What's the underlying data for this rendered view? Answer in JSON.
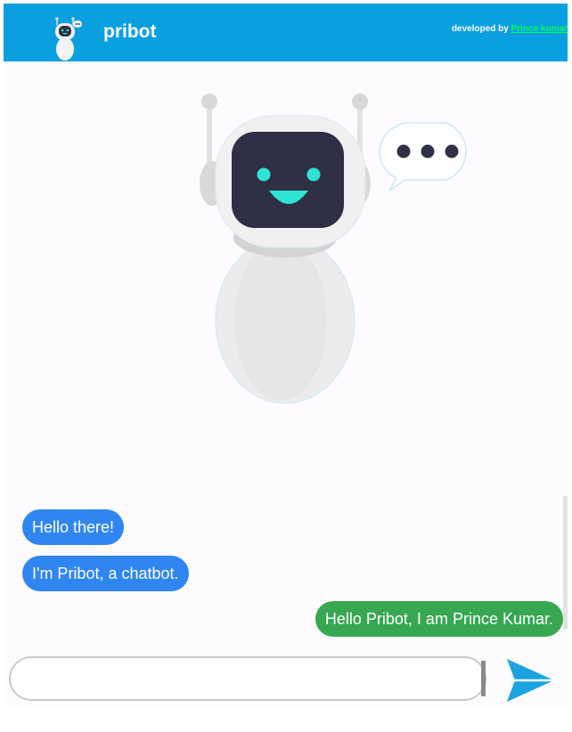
{
  "header": {
    "title": "pribot",
    "credit_prefix": "developed by ",
    "credit_name": "Prince kumar"
  },
  "messages": [
    {
      "from": "bot",
      "text": "Hello there!"
    },
    {
      "from": "bot",
      "text": "I'm Pribot, a chatbot."
    },
    {
      "from": "user",
      "text": "Hello Pribot, I am Prince Kumar."
    }
  ],
  "composer": {
    "value": "",
    "placeholder": ""
  },
  "icons": {
    "logo": "robot-logo-icon",
    "hero": "robot-illustration",
    "send": "send-icon"
  },
  "colors": {
    "header": "#0a9fe0",
    "bot_bubble": "#2f86f0",
    "user_bubble": "#37a851",
    "link": "#00ff55",
    "send": "#1aa3e0"
  }
}
